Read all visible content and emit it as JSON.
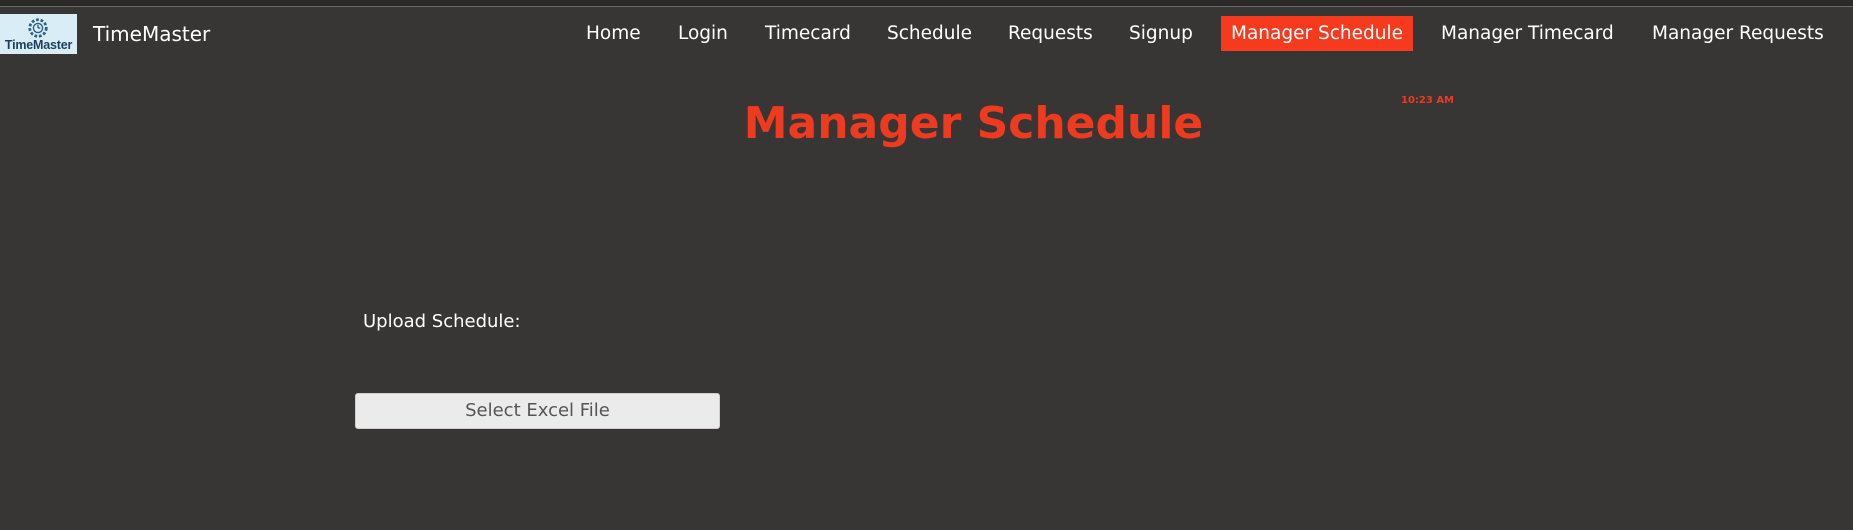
{
  "brand": {
    "logo_text": "TimeMaster",
    "name": "TimeMaster"
  },
  "nav": {
    "items": [
      {
        "label": "Home"
      },
      {
        "label": "Login"
      },
      {
        "label": "Timecard"
      },
      {
        "label": "Schedule"
      },
      {
        "label": "Requests"
      },
      {
        "label": "Signup"
      },
      {
        "label": "Manager Schedule",
        "active": true
      },
      {
        "label": "Manager Timecard"
      },
      {
        "label": "Manager Requests"
      }
    ]
  },
  "page": {
    "title": "Manager Schedule",
    "clock": "10:23 AM"
  },
  "upload": {
    "label": "Upload Schedule:",
    "button_label": "Select Excel File"
  },
  "colors": {
    "background": "#383634",
    "accent": "#f53a1e",
    "logo_bg": "#d8edf5"
  }
}
